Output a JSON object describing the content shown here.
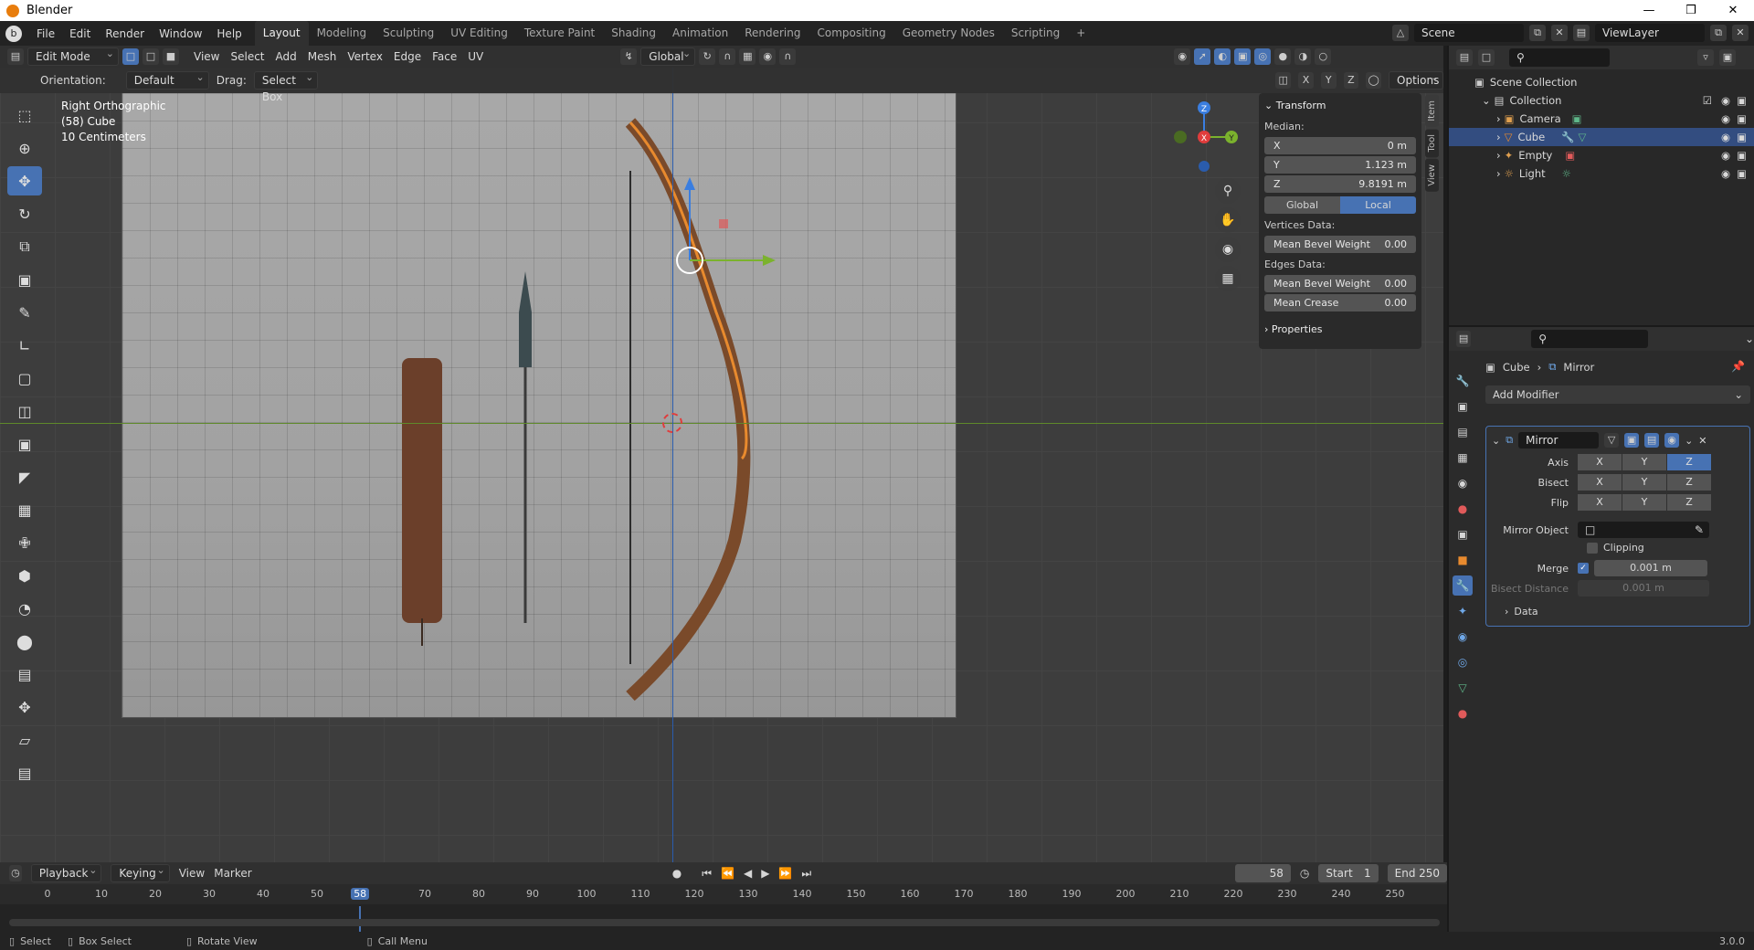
{
  "window": {
    "title": "Blender",
    "controls": [
      "—",
      "❒",
      "✕"
    ]
  },
  "menu": [
    "File",
    "Edit",
    "Render",
    "Window",
    "Help"
  ],
  "workspaces": [
    "Layout",
    "Modeling",
    "Sculpting",
    "UV Editing",
    "Texture Paint",
    "Shading",
    "Animation",
    "Rendering",
    "Compositing",
    "Geometry Nodes",
    "Scripting",
    "+"
  ],
  "scene": {
    "name": "Scene",
    "view_layer": "ViewLayer"
  },
  "viewport_header": {
    "mode": "Edit Mode",
    "menus": [
      "View",
      "Select",
      "Add",
      "Mesh",
      "Vertex",
      "Edge",
      "Face",
      "UV"
    ],
    "transform_orientation": "Global"
  },
  "viewport_sub": {
    "orientation_label": "Orientation:",
    "orientation": "Default",
    "drag_label": "Drag:",
    "drag": "Select Box",
    "options": "Options",
    "axes": [
      "X",
      "Y",
      "Z"
    ]
  },
  "overlay": {
    "view_name": "Right Orthographic",
    "object": "(58) Cube",
    "scale": "10 Centimeters"
  },
  "gizmo_axes": {
    "z": "Z",
    "y": "Y",
    "x": "X"
  },
  "npanel": {
    "title": "Transform",
    "median_label": "Median:",
    "median": [
      {
        "axis": "X",
        "value": "0 m"
      },
      {
        "axis": "Y",
        "value": "1.123 m"
      },
      {
        "axis": "Z",
        "value": "9.8191 m"
      }
    ],
    "space": [
      "Global",
      "Local"
    ],
    "vertices_label": "Vertices Data:",
    "vertex_rows": [
      {
        "label": "Mean Bevel Weight",
        "value": "0.00"
      }
    ],
    "edges_label": "Edges Data:",
    "edge_rows": [
      {
        "label": "Mean Bevel Weight",
        "value": "0.00"
      },
      {
        "label": "Mean Crease",
        "value": "0.00"
      }
    ],
    "properties": "Properties",
    "tabs": [
      "Item",
      "Tool",
      "View"
    ]
  },
  "outliner": {
    "root": "Scene Collection",
    "collection": "Collection",
    "items": [
      {
        "name": "Camera",
        "icon_color": "#e0a050",
        "selected": false
      },
      {
        "name": "Cube",
        "icon_color": "#e88a2e",
        "selected": true
      },
      {
        "name": "Empty",
        "icon_color": "#e0a050",
        "selected": false
      },
      {
        "name": "Light",
        "icon_color": "#e0a050",
        "selected": false
      }
    ]
  },
  "properties": {
    "breadcrumb_object": "Cube",
    "breadcrumb_modifier": "Mirror",
    "add_modifier": "Add Modifier",
    "modifier": {
      "name": "Mirror",
      "axis_label": "Axis",
      "bisect_label": "Bisect",
      "flip_label": "Flip",
      "xyz": [
        "X",
        "Y",
        "Z"
      ],
      "axis_active": "Z",
      "mirror_object_label": "Mirror Object",
      "clipping_label": "Clipping",
      "merge_label": "Merge",
      "merge_value": "0.001 m",
      "bisect_distance_label": "Bisect Distance",
      "bisect_distance_value": "0.001 m",
      "data_label": "Data"
    }
  },
  "timeline": {
    "menus": [
      "Playback",
      "Keying",
      "View",
      "Marker"
    ],
    "current_frame": "58",
    "start_label": "Start",
    "start": "1",
    "end_label": "End",
    "end": "250",
    "ruler": [
      "0",
      "10",
      "20",
      "30",
      "40",
      "50",
      "58",
      "70",
      "80",
      "90",
      "100",
      "110",
      "120",
      "130",
      "140",
      "150",
      "160",
      "170",
      "180",
      "190",
      "200",
      "210",
      "220",
      "230",
      "240",
      "250"
    ]
  },
  "statusbar": {
    "select": "Select",
    "box_select": "Box Select",
    "rotate": "Rotate View",
    "call_menu": "Call Menu",
    "version": "3.0.0"
  },
  "colors": {
    "accent": "#4772b3",
    "selection_orange": "#e88a2e",
    "x_axis": "#e03c3c",
    "y_axis": "#7bb22d",
    "z_axis": "#3a7ee0"
  }
}
